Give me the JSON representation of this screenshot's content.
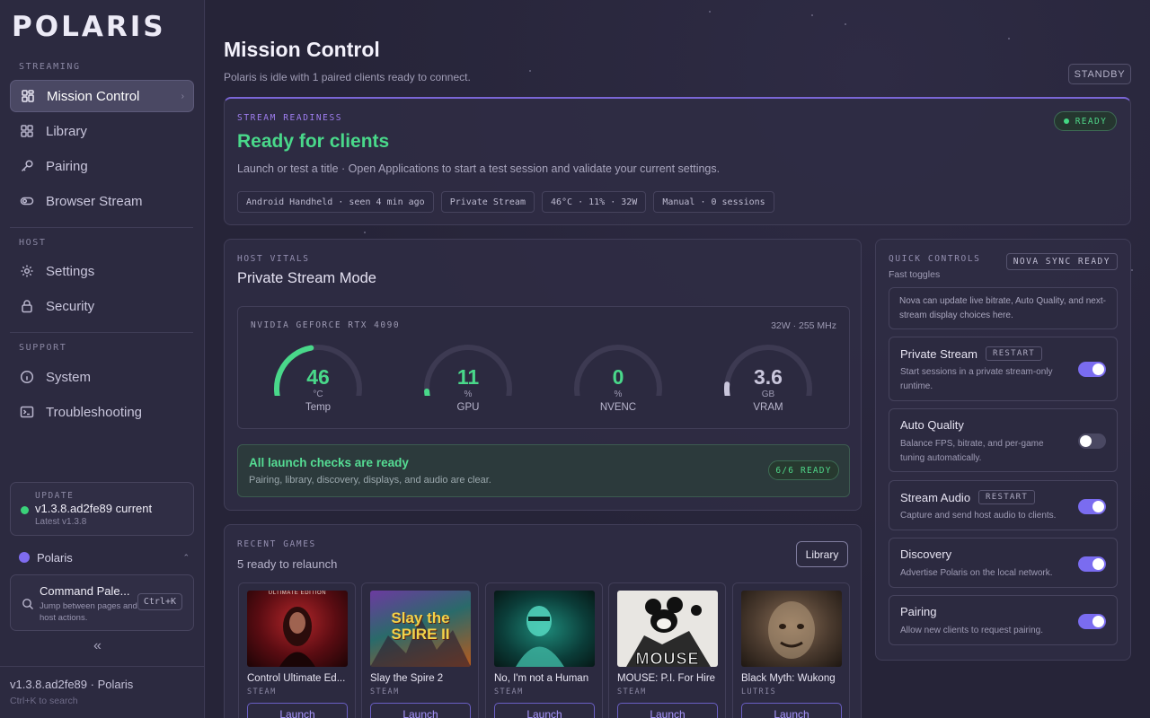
{
  "app": {
    "name": "POLARIS"
  },
  "sidebar": {
    "sections": [
      {
        "label": "STREAMING"
      },
      {
        "label": "HOST"
      },
      {
        "label": "SUPPORT"
      }
    ],
    "items": [
      {
        "label": "Mission Control",
        "icon": "grid-icon",
        "active": true
      },
      {
        "label": "Library",
        "icon": "apps-icon"
      },
      {
        "label": "Pairing",
        "icon": "key-icon"
      },
      {
        "label": "Browser Stream",
        "icon": "toggle-icon"
      },
      {
        "label": "Settings",
        "icon": "gear-icon"
      },
      {
        "label": "Security",
        "icon": "lock-icon"
      },
      {
        "label": "System",
        "icon": "info-icon"
      },
      {
        "label": "Troubleshooting",
        "icon": "terminal-icon"
      }
    ],
    "update": {
      "label": "UPDATE",
      "version": "v1.3.8.ad2fe89 current",
      "latest": "Latest v1.3.8"
    },
    "profile": {
      "name": "Polaris"
    },
    "command": {
      "title": "Command Pale...",
      "subtitle": "Jump between pages and host actions.",
      "shortcut": "Ctrl+K"
    },
    "footer": {
      "version": "v1.3.8.ad2fe89 · Polaris",
      "hint": "Ctrl+K to search"
    }
  },
  "header": {
    "title": "Mission Control",
    "subtitle": "Polaris is idle with 1 paired clients ready to connect.",
    "status_button": "STANDBY"
  },
  "readiness": {
    "eyebrow": "STREAM READINESS",
    "badge": "READY",
    "title": "Ready for clients",
    "description": "Launch or test a title · Open Applications to start a test session and validate your current settings.",
    "chips": [
      "Android Handheld · seen 4 min ago",
      "Private Stream",
      "46°C · 11% · 32W",
      "Manual · 0 sessions"
    ]
  },
  "vitals": {
    "eyebrow": "HOST VITALS",
    "title": "Private Stream Mode",
    "gpu_name": "NVIDIA GEFORCE RTX 4090",
    "gpu_stats": "32W · 255 MHz",
    "gauges": [
      {
        "value": "46",
        "unit": "°C",
        "label": "Temp",
        "fraction": 0.46,
        "color": "#49d88a"
      },
      {
        "value": "11",
        "unit": "%",
        "label": "GPU",
        "fraction": 0.11,
        "color": "#49d88a"
      },
      {
        "value": "0",
        "unit": "%",
        "label": "NVENC",
        "fraction": 0.0,
        "color": "#49d88a"
      },
      {
        "value": "3.6",
        "unit": "GB",
        "label": "VRAM",
        "fraction": 0.15,
        "color": "#c9c6dc"
      }
    ],
    "checks": {
      "title": "All launch checks are ready",
      "subtitle": "Pairing, library, discovery, displays, and audio are clear.",
      "badge": "6/6 READY"
    }
  },
  "recent_games": {
    "eyebrow": "RECENT GAMES",
    "subtitle": "5 ready to relaunch",
    "library_button": "Library",
    "launch_label": "Launch",
    "games": [
      {
        "title": "Control Ultimate Ed...",
        "source": "STEAM",
        "art_caption": "ULTIMATE EDITION"
      },
      {
        "title": "Slay the Spire 2",
        "source": "STEAM",
        "art_caption": "Slay the SPIRE II"
      },
      {
        "title": "No, I'm not a Human",
        "source": "STEAM"
      },
      {
        "title": "MOUSE: P.I. For Hire",
        "source": "STEAM",
        "art_caption": "MOUSE"
      },
      {
        "title": "Black Myth: Wukong",
        "source": "LUTRIS"
      }
    ]
  },
  "quick_controls": {
    "eyebrow": "QUICK CONTROLS",
    "subtitle": "Fast toggles",
    "badge": "NOVA SYNC READY",
    "note": "Nova can update live bitrate, Auto Quality, and next-stream display choices here.",
    "toggles": [
      {
        "title": "Private Stream",
        "badge": "RESTART",
        "description": "Start sessions in a private stream-only runtime.",
        "on": true
      },
      {
        "title": "Auto Quality",
        "badge": "",
        "description": "Balance FPS, bitrate, and per-game tuning automatically.",
        "on": false
      },
      {
        "title": "Stream Audio",
        "badge": "RESTART",
        "description": "Capture and send host audio to clients.",
        "on": true
      },
      {
        "title": "Discovery",
        "badge": "",
        "description": "Advertise Polaris on the local network.",
        "on": true
      },
      {
        "title": "Pairing",
        "badge": "",
        "description": "Allow new clients to request pairing.",
        "on": true
      }
    ]
  }
}
